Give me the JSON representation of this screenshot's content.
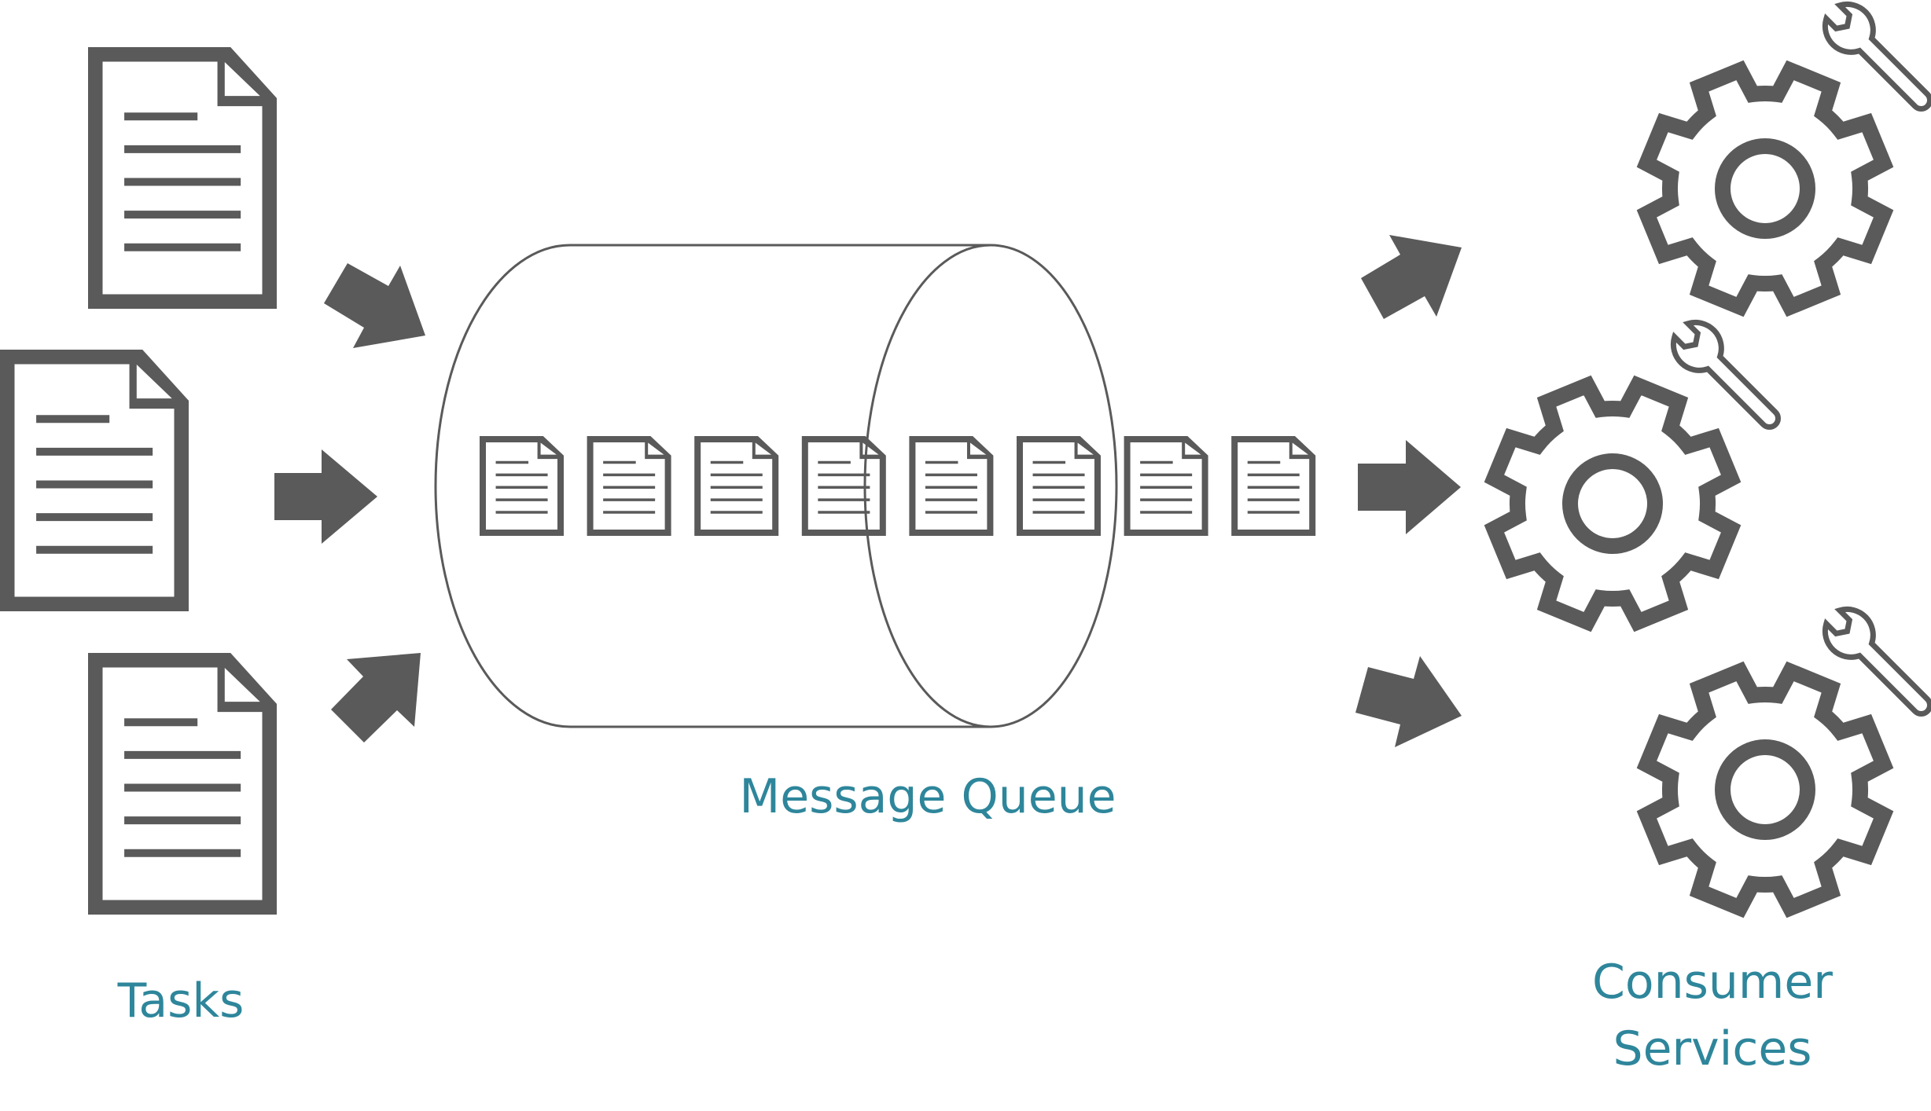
{
  "diagram": {
    "title": "Message Queue",
    "colors": {
      "icon": "#5a5a5a",
      "label": "#2e869b",
      "background": "#ffffff"
    },
    "labels": {
      "tasks": "Tasks",
      "queue": "Message Queue",
      "consumers_line1": "Consumer",
      "consumers_line2": "Services"
    },
    "tasks": [
      {
        "icon": "document-icon"
      },
      {
        "icon": "document-icon"
      },
      {
        "icon": "document-icon"
      }
    ],
    "queue": {
      "shape": "cylinder",
      "messages": [
        {
          "icon": "document-icon"
        },
        {
          "icon": "document-icon"
        },
        {
          "icon": "document-icon"
        },
        {
          "icon": "document-icon"
        },
        {
          "icon": "document-icon"
        },
        {
          "icon": "document-icon"
        },
        {
          "icon": "document-icon"
        },
        {
          "icon": "document-icon"
        }
      ]
    },
    "consumers": [
      {
        "icon": "gear-icon",
        "badge": "wrench-icon"
      },
      {
        "icon": "gear-icon",
        "badge": "wrench-icon"
      },
      {
        "icon": "gear-icon",
        "badge": "wrench-icon"
      }
    ],
    "edges": [
      {
        "from": "task-1",
        "to": "queue",
        "icon": "arrow-icon"
      },
      {
        "from": "task-2",
        "to": "queue",
        "icon": "arrow-icon"
      },
      {
        "from": "task-3",
        "to": "queue",
        "icon": "arrow-icon"
      },
      {
        "from": "queue",
        "to": "consumer-1",
        "icon": "arrow-icon"
      },
      {
        "from": "queue",
        "to": "consumer-2",
        "icon": "arrow-icon"
      },
      {
        "from": "queue",
        "to": "consumer-3",
        "icon": "arrow-icon"
      }
    ]
  }
}
